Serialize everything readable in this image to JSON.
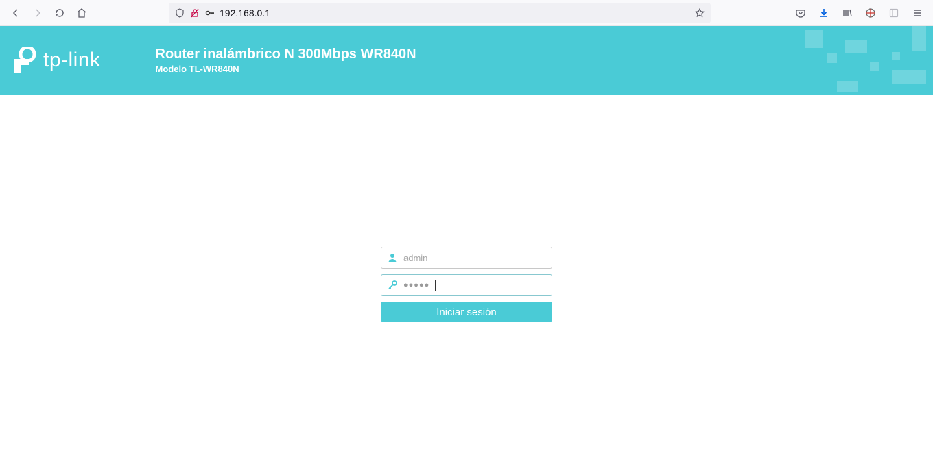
{
  "browser": {
    "url": "192.168.0.1"
  },
  "header": {
    "brand": "tp-link",
    "title": "Router inalámbrico N 300Mbps WR840N",
    "subtitle": "Modelo TL-WR840N"
  },
  "login": {
    "username_placeholder": "admin",
    "password_mask": "●●●●●",
    "button_label": "Iniciar sesión"
  }
}
